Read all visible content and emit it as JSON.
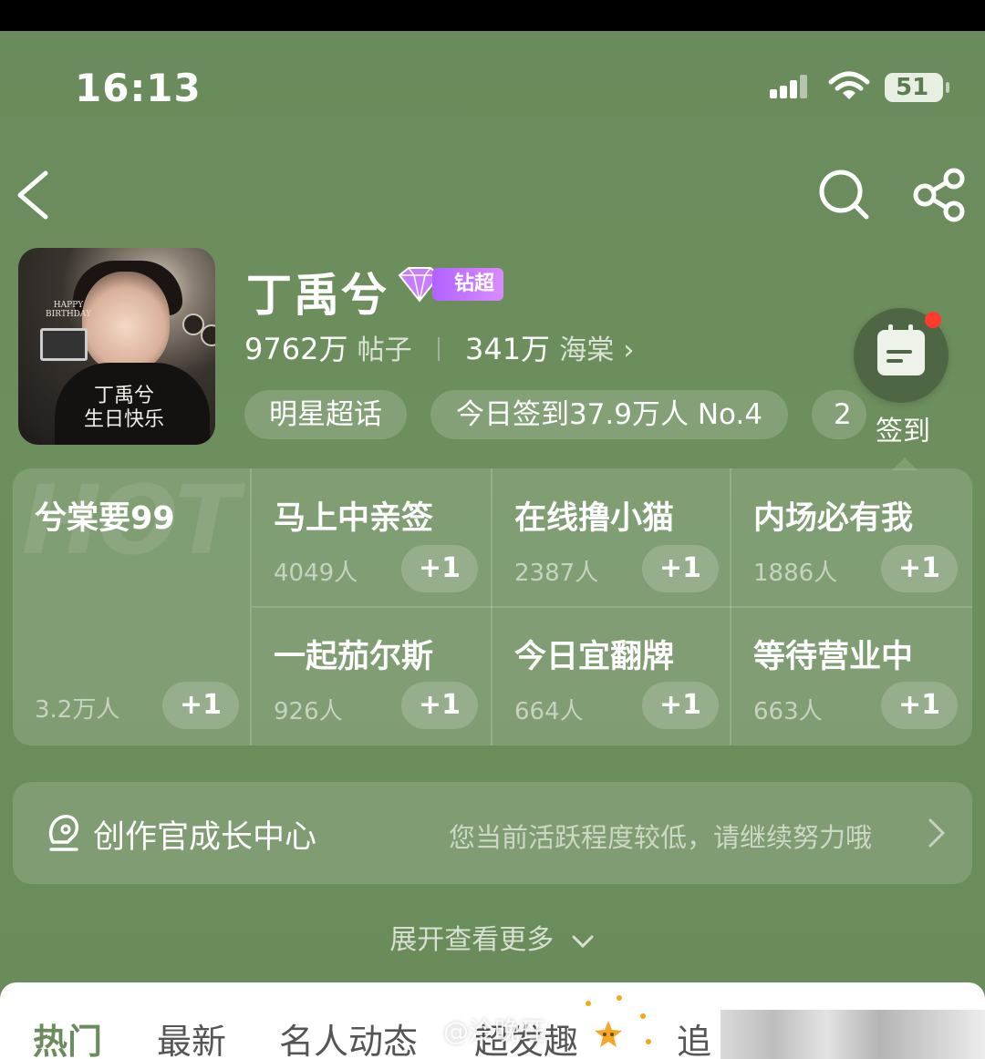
{
  "status_bar": {
    "time": "16:13",
    "battery": "51"
  },
  "header": {
    "name": "丁禹兮",
    "badge": "钻超",
    "posts_count": "9762万",
    "posts_label": "帖子",
    "fans_count": "341万",
    "fans_label": "海棠",
    "tags": [
      "明星超话",
      "今日签到37.9万人 No.4",
      "2"
    ],
    "checkin_label": "签到",
    "avatar_text": {
      "top": "HAPPY BIRTHDAY",
      "caption_1": "丁禹兮",
      "caption_2": "生日快乐"
    }
  },
  "hot_grid": {
    "watermark": "HOT",
    "cells": [
      {
        "title": "兮棠要99",
        "count": "3.2万人",
        "plus": "+1"
      },
      {
        "title": "马上中亲签",
        "count": "4049人",
        "plus": "+1"
      },
      {
        "title": "在线撸小猫",
        "count": "2387人",
        "plus": "+1"
      },
      {
        "title": "内场必有我",
        "count": "1886人",
        "plus": "+1"
      },
      {
        "title": "一起茄尔斯",
        "count": "926人",
        "plus": "+1"
      },
      {
        "title": "今日宜翻牌",
        "count": "664人",
        "plus": "+1"
      },
      {
        "title": "等待营业中",
        "count": "663人",
        "plus": "+1"
      }
    ]
  },
  "growth_center": {
    "title": "创作官成长中心",
    "desc": "您当前活跃程度较低，请继续努力哦"
  },
  "expand_more": "展开查看更多",
  "tabs": [
    "热门",
    "最新",
    "名人动态",
    "超发趣",
    "追"
  ],
  "watermark": "@泠晚珏",
  "colors": {
    "bg": "#6b8c5c",
    "badge": "#b162ff",
    "alert": "#ff3b30"
  }
}
